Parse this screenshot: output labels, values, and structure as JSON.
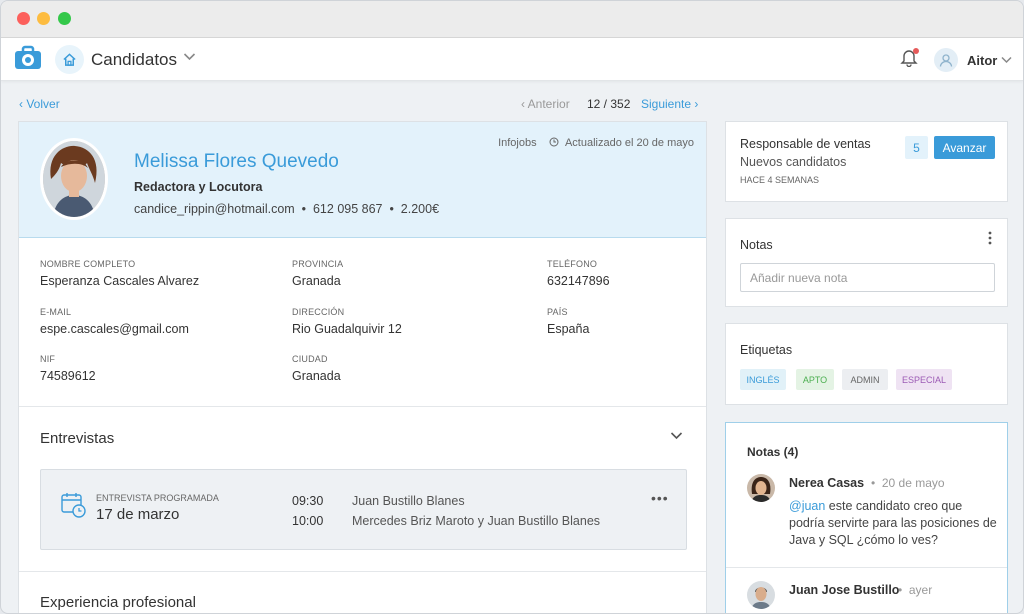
{
  "app": {
    "title": "Candidatos",
    "user": "Aitor"
  },
  "nav": {
    "back": "Volver",
    "prev": "Anterior",
    "counter": "12 / 352",
    "next": "Siguiente"
  },
  "candidate": {
    "name": "Melissa Flores Quevedo",
    "role": "Redactora y Locutora",
    "email": "candice_rippin@hotmail.com",
    "phone": "612 095 867",
    "salary": "2.200€",
    "sep": "•",
    "source": "Infojobs",
    "updated": "Actualizado el 20 de mayo"
  },
  "details": {
    "nombre_label": "NOMBRE COMPLETO",
    "nombre": "Esperanza Cascales Alvarez",
    "provincia_label": "PROVINCIA",
    "provincia": "Granada",
    "telefono_label": "TELÉFONO",
    "telefono": "632147896",
    "email_label": "E-MAIL",
    "email": "espe.cascales@gmail.com",
    "direccion_label": "DIRECCIÓN",
    "direccion": "Rio Guadalquivir 12",
    "pais_label": "PAÍS",
    "pais": "España",
    "nif_label": "NIF",
    "nif": "74589612",
    "ciudad_label": "CIUDAD",
    "ciudad": "Granada"
  },
  "interviews": {
    "title": "Entrevistas",
    "label": "ENTREVISTA PROGRAMADA",
    "date": "17 de marzo",
    "slots": [
      {
        "time": "09:30",
        "who": "Juan Bustillo Blanes"
      },
      {
        "time": "10:00",
        "who": "Mercedes Briz Maroto y Juan Bustillo Blanes"
      }
    ]
  },
  "experience": {
    "title": "Experiencia profesional"
  },
  "stage": {
    "title": "Responsable de ventas",
    "subtitle": "Nuevos candidatos",
    "time": "HACE 4 SEMANAS",
    "count": "5",
    "action": "Avanzar"
  },
  "notes_box": {
    "title": "Notas",
    "placeholder": "Añadir nueva nota"
  },
  "tags": {
    "title": "Etiquetas",
    "items": [
      {
        "label": "INGLÉS",
        "bg": "#e1f1f8",
        "fg": "#3a9bd9"
      },
      {
        "label": "APTO",
        "bg": "#e4f3e4",
        "fg": "#4caf50"
      },
      {
        "label": "ADMIN",
        "bg": "#eceef1",
        "fg": "#666666"
      },
      {
        "label": "ESPECIAL",
        "bg": "#efe3f3",
        "fg": "#9c5bb5"
      }
    ]
  },
  "comments": {
    "title": "Notas (4)",
    "sep": "•",
    "items": [
      {
        "author": "Nerea Casas",
        "date": "20 de mayo",
        "mention": "@juan",
        "text": " este candidato creo que podría servirte para las posiciones de Java y SQL ¿cómo lo ves?"
      },
      {
        "author": "Juan Jose Bustillo",
        "date": "ayer"
      }
    ]
  },
  "colors": {
    "accent": "#3a9bd9",
    "profile_bg": "#e3f2fb"
  }
}
